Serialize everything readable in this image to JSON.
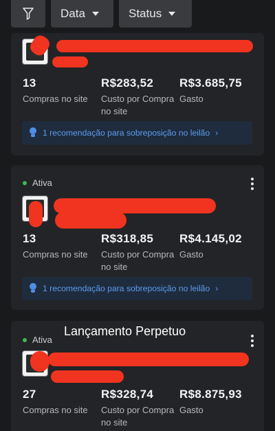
{
  "filters": {
    "date_label": "Data",
    "status_label": "Status"
  },
  "campaigns": [
    {
      "status": "",
      "stats": [
        {
          "value": "13",
          "label": "Compras no site"
        },
        {
          "value": "R$283,52",
          "label": "Custo por Compra no site"
        },
        {
          "value": "R$3.685,75",
          "label": "Gasto"
        }
      ],
      "recommendation": "1 recomendação para sobreposição no leilão"
    },
    {
      "status": "Ativa",
      "stats": [
        {
          "value": "13",
          "label": "Compras no site"
        },
        {
          "value": "R$318,85",
          "label": "Custo por Compra no site"
        },
        {
          "value": "R$4.145,02",
          "label": "Gasto"
        }
      ],
      "recommendation": "1 recomendação para sobreposição no leilão"
    },
    {
      "status": "Ativa",
      "stats": [
        {
          "value": "27",
          "label": "Compras no site"
        },
        {
          "value": "R$328,74",
          "label": "Custo por Compra no site"
        },
        {
          "value": "R$8.875,93",
          "label": "Gasto"
        }
      ]
    }
  ],
  "caption": "Lançamento Perpetuo",
  "colors": {
    "background": "#191a1c",
    "card": "#232427",
    "active_dot": "#3fb950",
    "recommendation_text": "#5d9bf0",
    "redaction": "#f0341f"
  },
  "icons": {
    "filter": "funnel-icon",
    "dropdown": "caret-down-icon",
    "recommendation": "lightbulb-icon",
    "more": "kebab-icon"
  }
}
